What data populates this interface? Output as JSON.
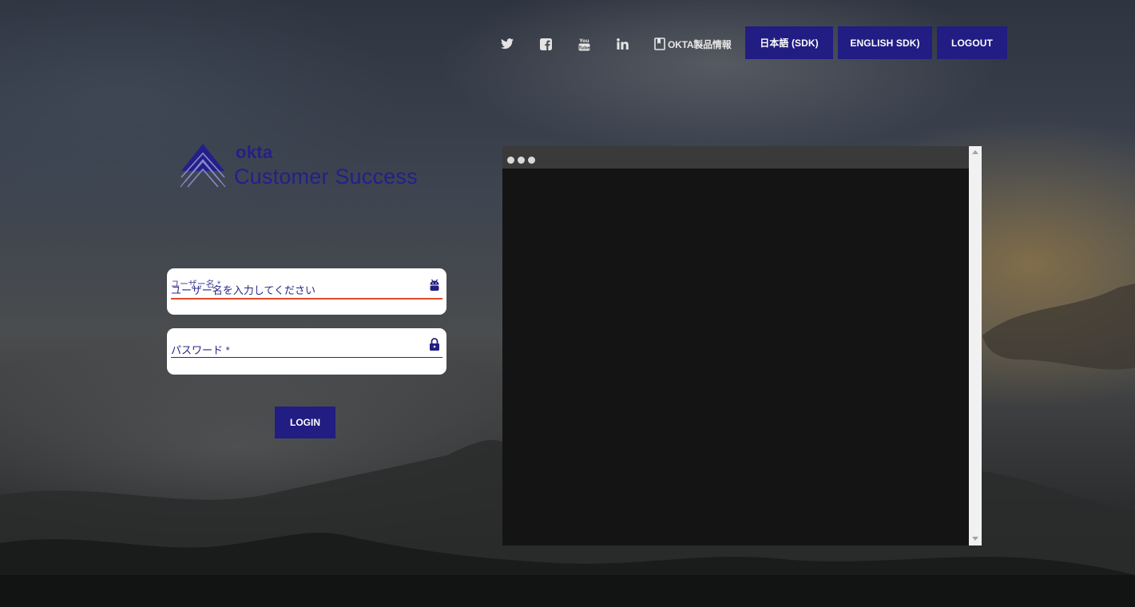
{
  "nav": {
    "social_icons": [
      "twitter-icon",
      "facebook-icon",
      "youtube-icon",
      "linkedin-icon"
    ],
    "product_info_label": "OKTA製品情報",
    "japanese_sdk_label": "日本語 (SDK)",
    "english_sdk_label": "ENGLISH SDK)",
    "logout_label": "LOGOUT"
  },
  "logo": {
    "wordmark": "okta",
    "subtitle": "Customer Success"
  },
  "form": {
    "username": {
      "floating_label": "ユーザー名 *",
      "placeholder": "ユーザー名を入力してください",
      "icon": "android-icon"
    },
    "password": {
      "label": "パスワード *",
      "icon": "lock-icon"
    },
    "login_label": "LOGIN"
  },
  "console": {
    "window_dots": 3
  },
  "colors": {
    "accent": "#211d82",
    "error_underline": "#e04a2a",
    "console_bg": "#141414",
    "console_bar": "#3a3a3a"
  }
}
